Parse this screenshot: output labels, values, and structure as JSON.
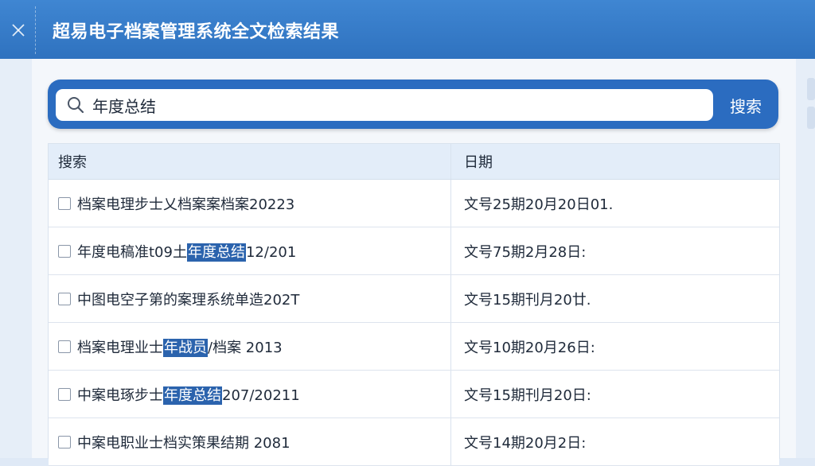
{
  "window": {
    "title": "超易电子档案管理系统全文检索结果",
    "close_icon": "close-icon"
  },
  "search": {
    "value": "年度总结",
    "button_label": "搜索",
    "icon": "search-icon"
  },
  "table": {
    "headers": [
      "搜索",
      "日期"
    ],
    "rows": [
      {
        "pre": "档案电理步士乂档案案档案20223",
        "hl": "",
        "post": "",
        "date": "文号25期20月20日01."
      },
      {
        "pre": "年度电稿准t09土",
        "hl": "年度总结",
        "post": "12/201",
        "date": "文号75期2月28日:"
      },
      {
        "pre": "中图电空子第的案理系统单造202T",
        "hl": "",
        "post": "",
        "date": "文号15期刊月20廿."
      },
      {
        "pre": "档案电理业士",
        "hl": "年战员",
        "post": "/档案 2013",
        "date": "文号10期20月26日:"
      },
      {
        "pre": "中案电琢步士",
        "hl": "年度总结",
        "post": "207/20211",
        "date": "文号15期刊月20日:"
      },
      {
        "pre": "中案电职业士档实策果结期 2081",
        "hl": "",
        "post": "",
        "date": "文号14期20月2日:"
      }
    ]
  }
}
